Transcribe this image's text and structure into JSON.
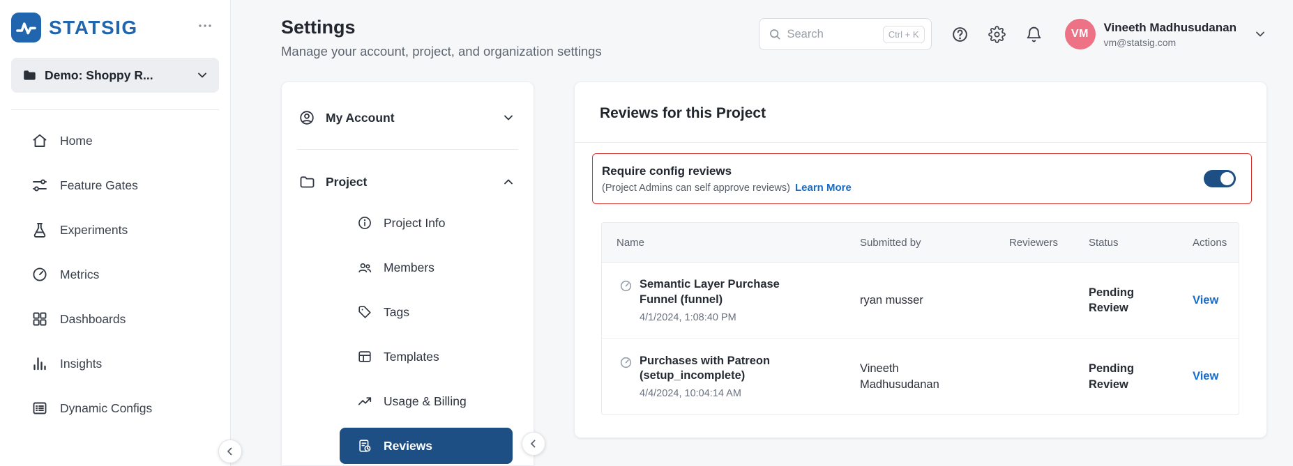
{
  "colors": {
    "brand_blue": "#2065ad",
    "selected_navy": "#1d4f85",
    "link_blue": "#176cc7",
    "alert_red": "#d93030",
    "avatar_pink": "#ee7286",
    "toggle_on": "#1d4f85"
  },
  "brand": {
    "name": "STATSIG"
  },
  "sidebar": {
    "project_selector": {
      "label": "Demo: Shoppy R..."
    },
    "items": [
      {
        "label": "Home",
        "icon": "home-icon"
      },
      {
        "label": "Feature Gates",
        "icon": "feature-gates-icon"
      },
      {
        "label": "Experiments",
        "icon": "experiments-icon"
      },
      {
        "label": "Metrics",
        "icon": "metrics-icon"
      },
      {
        "label": "Dashboards",
        "icon": "dashboards-icon"
      },
      {
        "label": "Insights",
        "icon": "insights-icon"
      },
      {
        "label": "Dynamic Configs",
        "icon": "dynamic-configs-icon"
      }
    ]
  },
  "header": {
    "title": "Settings",
    "subtitle": "Manage your account, project, and organization settings",
    "search": {
      "placeholder": "Search",
      "shortcut": "Ctrl + K"
    },
    "user": {
      "initials": "VM",
      "name": "Vineeth Madhusudanan",
      "email": "vm@statsig.com"
    }
  },
  "settings_nav": {
    "my_account": {
      "label": "My Account",
      "state": "collapsed"
    },
    "project": {
      "label": "Project",
      "state": "expanded"
    },
    "project_items": [
      {
        "label": "Project Info"
      },
      {
        "label": "Members"
      },
      {
        "label": "Tags"
      },
      {
        "label": "Templates"
      },
      {
        "label": "Usage & Billing"
      },
      {
        "label": "Reviews",
        "selected": true
      }
    ]
  },
  "main": {
    "title": "Reviews for this Project",
    "require_reviews": {
      "title": "Require config reviews",
      "subtitle": "(Project Admins can self approve reviews)",
      "link": "Learn More",
      "toggle_on": true
    },
    "table": {
      "columns": [
        "Name",
        "Submitted by",
        "Reviewers",
        "Status",
        "Actions"
      ],
      "rows": [
        {
          "name": "Semantic Layer Purchase Funnel (funnel)",
          "timestamp": "4/1/2024, 1:08:40 PM",
          "submitted_by": "ryan musser",
          "reviewers": "",
          "status": "Pending Review",
          "action": "View"
        },
        {
          "name": "Purchases with Patreon (setup_incomplete)",
          "timestamp": "4/4/2024, 10:04:14 AM",
          "submitted_by": "Vineeth Madhusudanan",
          "reviewers": "",
          "status": "Pending Review",
          "action": "View"
        }
      ]
    }
  }
}
